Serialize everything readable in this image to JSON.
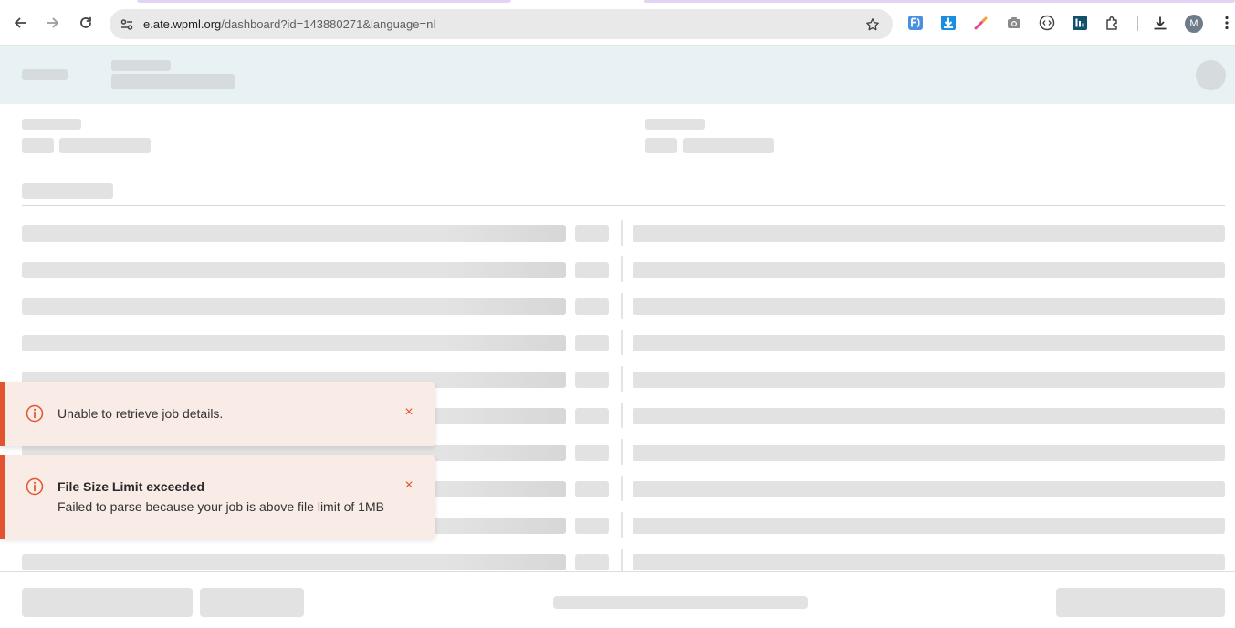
{
  "browser": {
    "url_host": "e.ate.wpml.org",
    "url_path": "/dashboard?id=143880271&language=nl",
    "avatar_letter": "M",
    "colors": {
      "tab_accent": "#e3d3f4",
      "omnibox": "#e9e9e9"
    },
    "icons": [
      "back-arrow-icon",
      "forward-arrow-icon",
      "reload-icon",
      "site-info-icon",
      "star-icon",
      "extension-f-icon",
      "download-extension-icon",
      "color-picker-icon",
      "camera-icon",
      "code-icon",
      "chart-extension-icon",
      "puzzle-icon",
      "downloads-icon",
      "kebab-menu-icon"
    ]
  },
  "notifications": [
    {
      "title": "",
      "message": "Unable to retrieve job details.",
      "close_label": "×"
    },
    {
      "title": "File Size Limit exceeded",
      "message": "Failed to parse because your job is above file limit of 1MB",
      "close_label": "×"
    }
  ],
  "colors": {
    "header_bg": "#e8f1f3",
    "skeleton": "#e2e2e2",
    "toast_bg": "#f9ebe6",
    "toast_accent": "#e0552f"
  }
}
